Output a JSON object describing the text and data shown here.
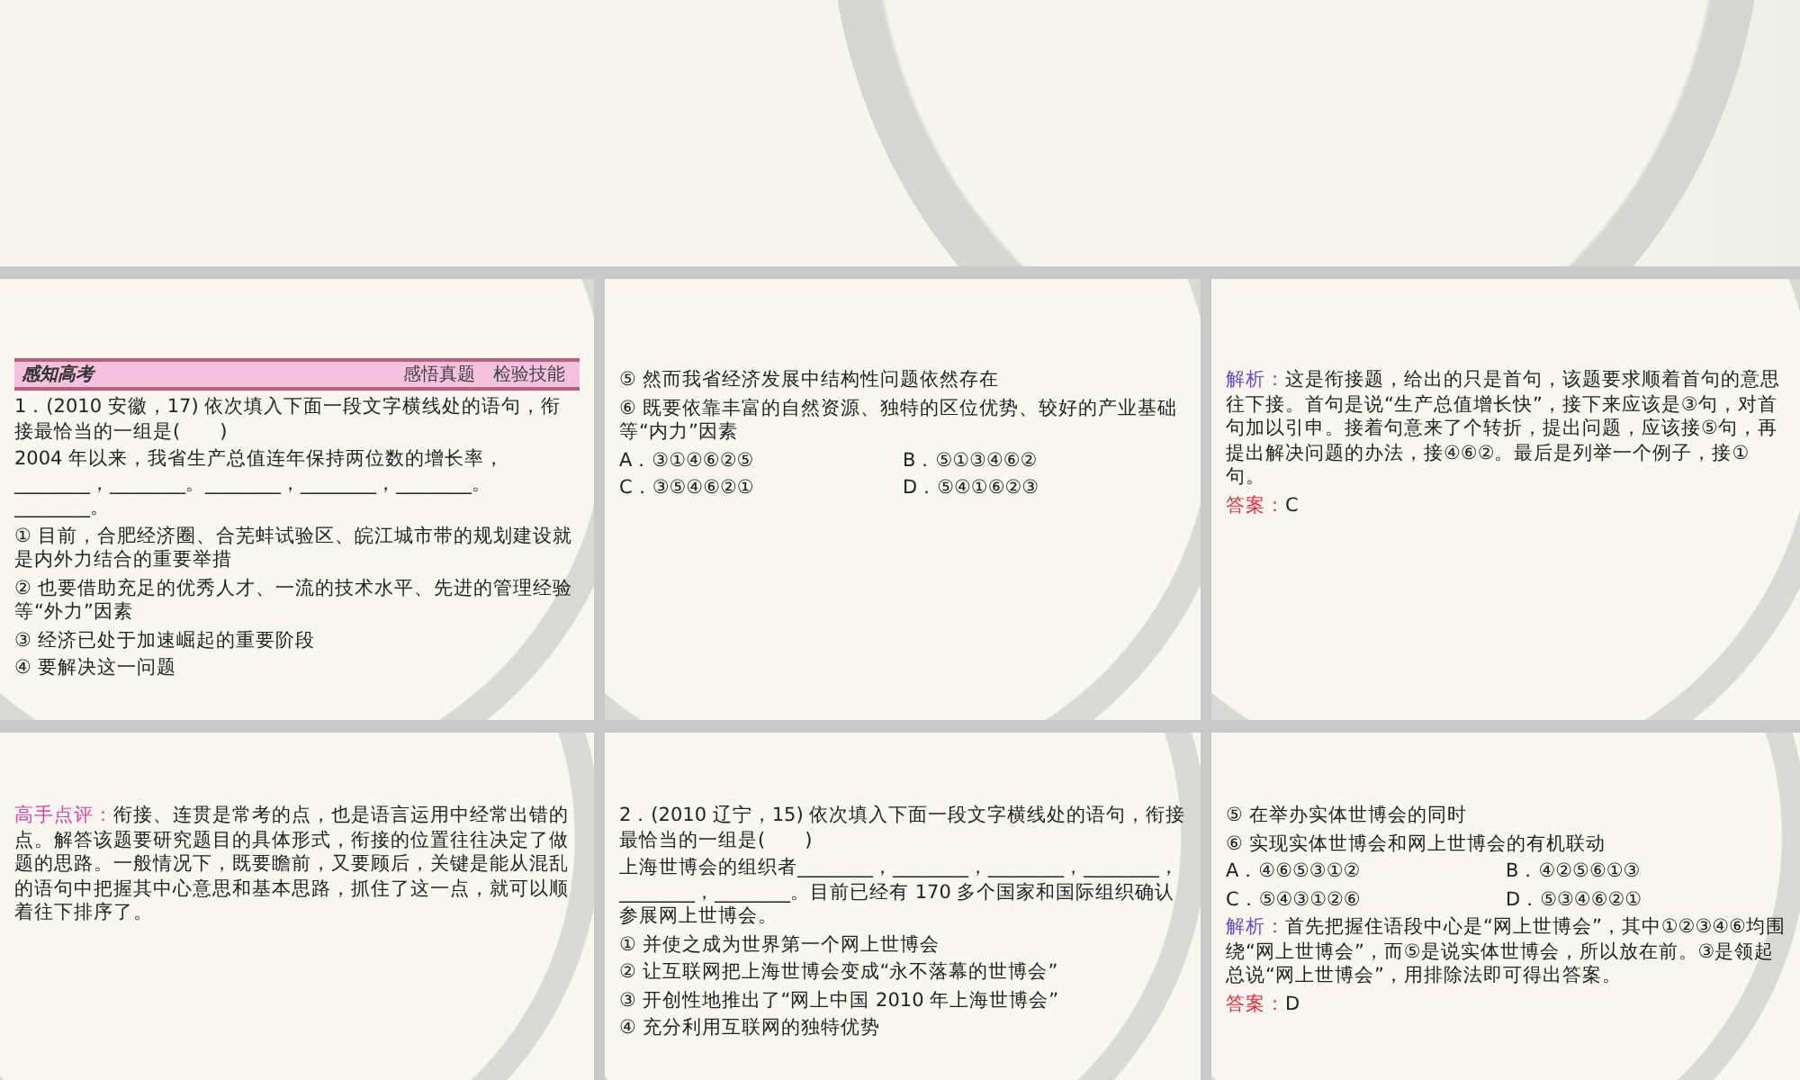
{
  "slides": [
    {
      "header": {
        "title": "感知高考",
        "subtitle": "感悟真题　检验技能"
      },
      "blocks": [
        {
          "kind": "text",
          "text": "1．(2010 安徽，17) 依次填入下面一段文字横线处的语句，衔接最恰当的一组是(　　)"
        },
        {
          "kind": "text",
          "text": "2004 年以来，我省生产总值连年保持两位数的增长率，________，________。________，________，________。________。"
        },
        {
          "kind": "text",
          "text": "① 目前，合肥经济圈、合芜蚌试验区、皖江城市带的规划建设就是内外力结合的重要举措"
        },
        {
          "kind": "text",
          "text": "② 也要借助充足的优秀人才、一流的技术水平、先进的管理经验等“外力”因素"
        },
        {
          "kind": "text",
          "text": "③ 经济已处于加速崛起的重要阶段"
        },
        {
          "kind": "text",
          "text": "④ 要解决这一问题"
        }
      ]
    },
    {
      "blocks": [
        {
          "kind": "text",
          "text": "⑤ 然而我省经济发展中结构性问题依然存在"
        },
        {
          "kind": "text",
          "text": "⑥ 既要依靠丰富的自然资源、独特的区位优势、较好的产业基础等“内力”因素"
        },
        {
          "kind": "choices",
          "items": [
            "A．③①④⑥②⑤",
            "B．⑤①③④⑥②",
            "C．③⑤④⑥②①",
            "D．⑤④①⑥②③"
          ]
        }
      ]
    },
    {
      "blocks": [
        {
          "kind": "analysis",
          "label": "解析：",
          "text": "这是衔接题，给出的只是首句，该题要求顺着首句的意思往下接。首句是说“生产总值增长快”，接下来应该是③句，对首句加以引申。接着句意来了个转折，提出问题，应该接⑤句，再提出解决问题的办法，接④⑥②。最后是列举一个例子，接①句。"
        },
        {
          "kind": "answer",
          "label": "答案：",
          "text": "C"
        }
      ]
    },
    {
      "blocks": [
        {
          "kind": "comment",
          "label": "高手点评：",
          "text": "衔接、连贯是常考的点，也是语言运用中经常出错的点。解答该题要研究题目的具体形式，衔接的位置往往决定了做题的思路。一般情况下，既要瞻前，又要顾后，关键是能从混乱的语句中把握其中心意思和基本思路，抓住了这一点，就可以顺着往下排序了。"
        }
      ]
    },
    {
      "blocks": [
        {
          "kind": "text",
          "text": "2．(2010 辽宁，15) 依次填入下面一段文字横线处的语句，衔接最恰当的一组是(　　)"
        },
        {
          "kind": "text",
          "text": "上海世博会的组织者________，________，________，________，________，________。目前已经有 170 多个国家和国际组织确认参展网上世博会。"
        },
        {
          "kind": "text",
          "text": "① 并使之成为世界第一个网上世博会"
        },
        {
          "kind": "text",
          "text": "② 让互联网把上海世博会变成“永不落幕的世博会”"
        },
        {
          "kind": "text",
          "text": "③ 开创性地推出了“网上中国 2010 年上海世博会”"
        },
        {
          "kind": "text",
          "text": "④ 充分利用互联网的独特优势"
        }
      ]
    },
    {
      "blocks": [
        {
          "kind": "text",
          "text": "⑤ 在举办实体世博会的同时"
        },
        {
          "kind": "text",
          "text": "⑥ 实现实体世博会和网上世博会的有机联动"
        },
        {
          "kind": "choices",
          "items": [
            "A．④⑥⑤③①②",
            "B．④②⑤⑥①③",
            "C．⑤④③①②⑥",
            "D．⑤③④⑥②①"
          ]
        },
        {
          "kind": "analysis",
          "label": "解析：",
          "text": "首先把握住语段中心是“网上世博会”，其中①②③④⑥均围绕“网上世博会”，而⑤是说实体世博会，所以放在前。③是领起总说“网上世博会”，用排除法即可得出答案。"
        },
        {
          "kind": "answer",
          "label": "答案：",
          "text": "D"
        }
      ]
    }
  ]
}
